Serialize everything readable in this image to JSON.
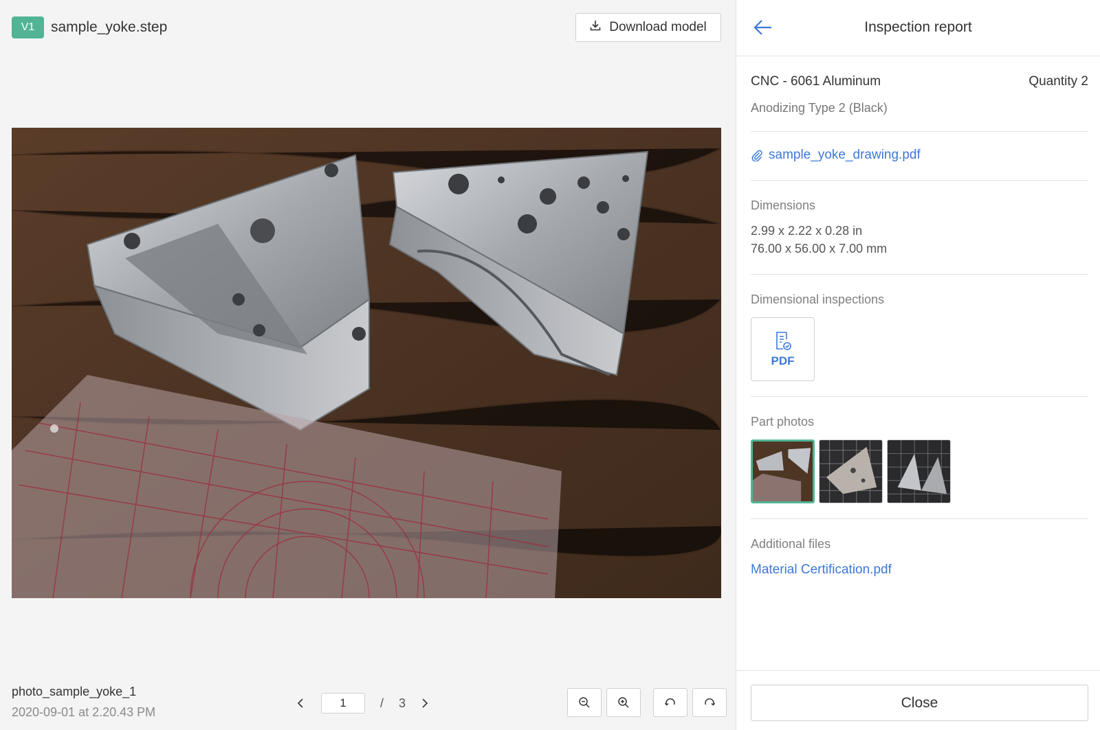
{
  "viewer": {
    "version_badge": "V1",
    "file_name": "sample_yoke.step",
    "download_label": "Download model",
    "photo_caption": "photo_sample_yoke_1",
    "photo_date": "2020-09-01 at 2.20.43 PM",
    "pager": {
      "current_page": "1",
      "separator": "/",
      "total_pages": "3"
    },
    "icons": {
      "download": "download-icon",
      "prev": "chevron-left-icon",
      "next": "chevron-right-icon",
      "zoom_out": "zoom-out-icon",
      "zoom_in": "zoom-in-icon",
      "rotate_left": "rotate-left-icon",
      "rotate_right": "rotate-right-icon"
    }
  },
  "panel": {
    "title": "Inspection report",
    "process": "CNC - 6061 Aluminum",
    "quantity": "Quantity 2",
    "finish": "Anodizing Type 2 (Black)",
    "drawing_file": "sample_yoke_drawing.pdf",
    "dimensions_title": "Dimensions",
    "dimensions_in": "2.99 x 2.22 x 0.28 in",
    "dimensions_mm": "76.00 x 56.00 x 7.00 mm",
    "inspections_title": "Dimensional inspections",
    "inspection_pdf_label": "PDF",
    "photos_title": "Part photos",
    "photo_count": 3,
    "active_photo_index": 0,
    "additional_title": "Additional files",
    "additional_file": "Material Certification.pdf",
    "close_label": "Close"
  },
  "colors": {
    "accent_green": "#52b494",
    "link_blue": "#3c78d8",
    "background": "#f4f4f4"
  }
}
